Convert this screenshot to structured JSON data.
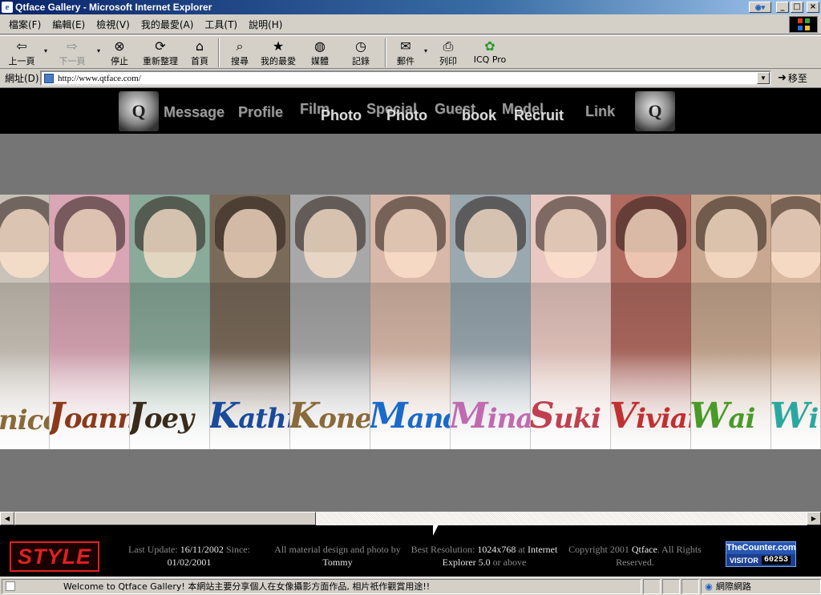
{
  "window": {
    "title": "Qtface Gallery - Microsoft Internet Explorer",
    "buttons": {
      "minimize": "_",
      "maximize": "□",
      "close": "×"
    }
  },
  "menu": [
    "檔案(F)",
    "編輯(E)",
    "檢視(V)",
    "我的最愛(A)",
    "工具(T)",
    "說明(H)"
  ],
  "toolbar": {
    "back": "上一頁",
    "forward": "下一頁",
    "stop": "停止",
    "refresh": "重新整理",
    "home": "首頁",
    "search": "搜尋",
    "favorites": "我的最愛",
    "media": "媒體",
    "history": "記錄",
    "mail": "郵件",
    "print": "列印",
    "icq": "ICQ Pro"
  },
  "address": {
    "label": "網址(D)",
    "url": "http://www.qtface.com/",
    "go": "移至"
  },
  "site_nav": {
    "message": "Message",
    "profile": "Profile",
    "film": "Film",
    "photo1": "Photo",
    "special": "Special",
    "photo2": "Photo",
    "guest": "Guest",
    "book": "book",
    "model": "Model",
    "recruit": "Recruit",
    "link": "Link"
  },
  "models": [
    {
      "name": "Janice",
      "visible": "nice",
      "color": "#8a6a3a",
      "bg": "#c9c2b8"
    },
    {
      "name": "Joanna",
      "visible": "oanna",
      "color": "#8a3a1a",
      "bg": "#d9a6b6"
    },
    {
      "name": "Joey",
      "visible": "oey",
      "color": "#3a2a1a",
      "bg": "#8aaa9a"
    },
    {
      "name": "Kathryn",
      "visible": "athry",
      "color": "#1a4a9a",
      "bg": "#7a6a5a"
    },
    {
      "name": "Koney",
      "visible": "oney",
      "color": "#8a6a3a",
      "bg": "#a8a8a8"
    },
    {
      "name": "Mandy",
      "visible": "andy",
      "color": "#1a6aca",
      "bg": "#d8b8a8"
    },
    {
      "name": "Mina",
      "visible": "ina",
      "color": "#c06ab0",
      "bg": "#9aa8b0"
    },
    {
      "name": "Suki",
      "visible": "uki",
      "color": "#c04050",
      "bg": "#e8c8c0"
    },
    {
      "name": "Vivian",
      "visible": "ivian",
      "color": "#c03030",
      "bg": "#b06a60"
    },
    {
      "name": "Wai",
      "visible": "ai",
      "color": "#4a9a2a",
      "bg": "#c8a890"
    },
    {
      "name": "Wi",
      "visible": "i",
      "color": "#2aa8a0",
      "bg": "#d8b8a0"
    }
  ],
  "model_initials": [
    "J",
    "J",
    "J",
    "K",
    "K",
    "M",
    "M",
    "S",
    "V",
    "W",
    "W"
  ],
  "footer": {
    "logo": "STYLE",
    "last_update_label": "Last Update:",
    "last_update": "16/11/2002",
    "since_label": "Since:",
    "since": "01/02/2001",
    "design_label": "All material design and photo by",
    "design_by": "Tommy",
    "resolution_label": "Best Resolution:",
    "resolution": "1024x768",
    "at": "at",
    "browser": "Internet Explorer 5.0",
    "or_above": "or above",
    "copyright_pre": "Copyright 2001",
    "copyright_name": "Qtface",
    "copyright_post": ". All Rights Reserved.",
    "counter_title": "TheCounter.com",
    "counter_visitor": "VISITOR",
    "counter_value": "60253"
  },
  "status": {
    "text": "Welcome to Qtface Gallery! 本網站主要分享個人在女像攝影方面作品, 相片祇作觀賞用途!!",
    "zone": "網際網路"
  }
}
